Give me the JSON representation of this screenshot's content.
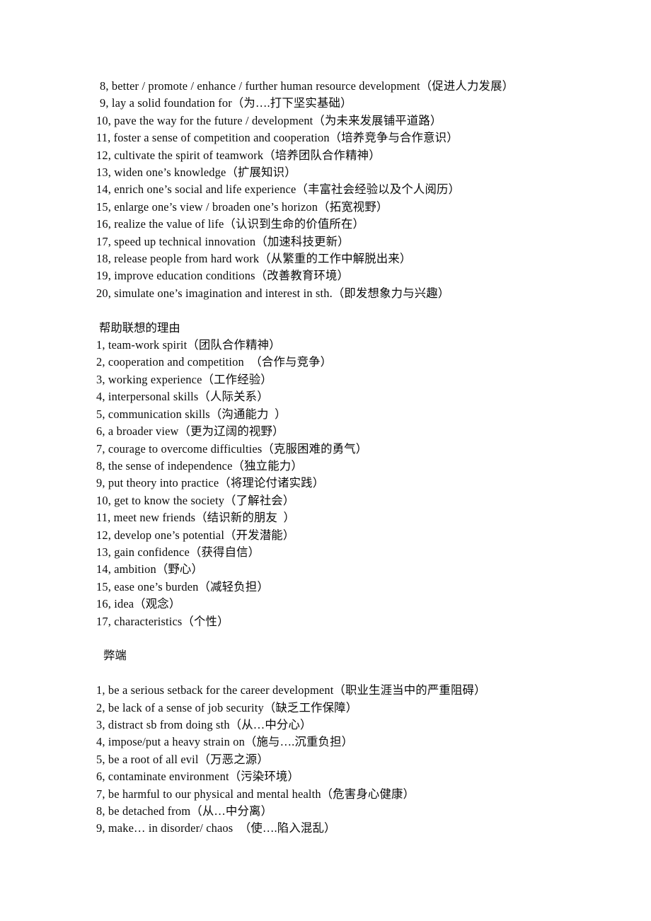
{
  "document": {
    "title": "English Essay Phrases with Chinese Glosses",
    "background_color": "#ffffff",
    "text_color": "#0b0b0b"
  },
  "sections": [
    {
      "id": "benefits-continued",
      "heading": null,
      "items": [
        "8, better / promote / enhance / further human resource development（促进人力发展）",
        "9, lay a solid foundation for（为….打下坚实基础）",
        "10, pave the way for the future / development（为未来发展铺平道路）",
        "11, foster a sense of competition and cooperation（培养竞争与合作意识）",
        "12, cultivate the spirit of teamwork（培养团队合作精神）",
        "13, widen one’s knowledge（扩展知识）",
        "14, enrich one’s social and life experience（丰富社会经验以及个人阅历）",
        "15, enlarge one’s view / broaden one’s horizon（拓宽视野）",
        "16, realize the value of life（认识到生命的价值所在）",
        "17, speed up technical innovation（加速科技更新）",
        "18, release people from hard work（从繁重的工作中解脱出来）",
        "19, improve education conditions（改善教育环境）",
        "20, simulate one’s imagination and interest in sth.（即发想象力与兴趣）"
      ]
    },
    {
      "id": "helpful-associations",
      "heading": "帮助联想的理由",
      "items": [
        "1, team-work spirit（团队合作精神）",
        "2, cooperation and competition  （合作与竞争）",
        "3, working experience（工作经验）",
        "4, interpersonal skills（人际关系）",
        "5, communication skills（沟通能力  ）",
        "6, a broader view（更为辽阔的视野）",
        "7, courage to overcome difficulties（克服困难的勇气）",
        "8, the sense of independence（独立能力）",
        "9, put theory into practice（将理论付诸实践）",
        "10, get to know the society（了解社会）",
        "11, meet new friends（结识新的朋友  ）",
        "12, develop one’s potential（开发潜能）",
        "13, gain confidence（获得自信）",
        "14, ambition（野心）",
        "15, ease one’s burden（减轻负担）",
        "16, idea（观念）",
        "17, characteristics（个性）"
      ]
    },
    {
      "id": "drawbacks",
      "heading": "弊端",
      "items": [
        "1, be a serious setback for the career development（职业生涯当中的严重阻碍）",
        "2, be lack of a sense of job security（缺乏工作保障）",
        "3, distract sb from doing sth（从…中分心）",
        "4, impose/put a heavy strain on（施与….沉重负担）",
        "5, be a root of all evil（万恶之源）",
        "6, contaminate environment（污染环境）",
        "7, be harmful to our physical and mental health（危害身心健康）",
        "8, be detached from（从…中分离）",
        "9, make… in disorder/ chaos  （使….陷入混乱）"
      ]
    }
  ]
}
